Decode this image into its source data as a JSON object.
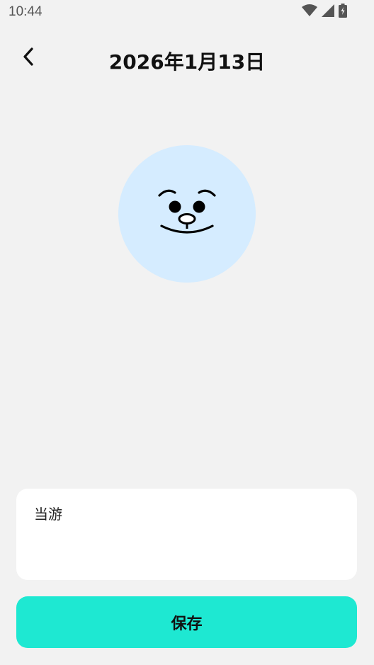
{
  "status_bar": {
    "time": "10:44",
    "icons": [
      "wifi-icon",
      "signal-icon",
      "battery-icon"
    ]
  },
  "header": {
    "back_icon": "chevron-left-icon",
    "title": "2026年1月13日"
  },
  "mood": {
    "icon": "smiling-bear-face-icon",
    "background_color": "#d5ecff"
  },
  "note": {
    "text": "当游"
  },
  "save_button": {
    "label": "保存",
    "color": "#1ee8d2"
  }
}
